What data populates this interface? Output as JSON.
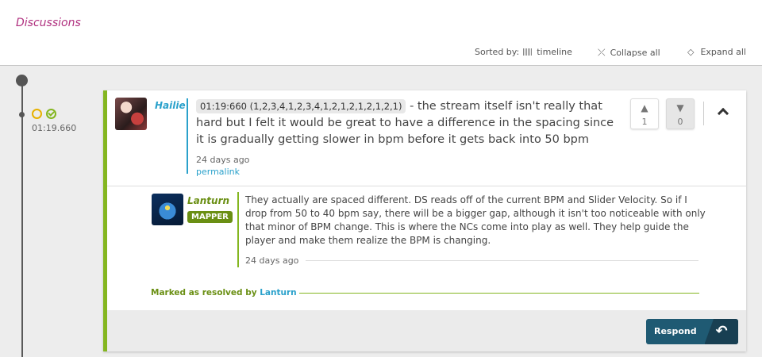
{
  "header": {
    "title": "Discussions",
    "sorted_by_label": "Sorted by:",
    "sort_value": "timeline",
    "collapse_all": "Collapse all",
    "expand_all": "Expand all"
  },
  "timeline": {
    "timestamp": "01:19.660"
  },
  "discussion": {
    "author": "Hailie",
    "timestamp_tag": "01:19:660 (1,2,3,4,1,2,3,4,1,2,1,2,1,2,1,2,1)",
    "message": " - the stream itself isn't really that hard but I felt it would be great to have a difference in the spacing since it is gradually getting slower in bpm before it gets back into 50 bpm",
    "date": "24 days ago",
    "permalink": "permalink",
    "upvotes": "1",
    "downvotes": "0"
  },
  "reply": {
    "author": "Lanturn",
    "badge": "MAPPER",
    "message": "They actually are spaced different. DS reads off of the current BPM and Slider Velocity. So if I drop from 50 to 40 bpm say, there will be a bigger gap, although it isn't too noticeable with only that minor of BPM change. This is where the NCs come into play as well. They help guide the player and make them realize the BPM is changing.",
    "date": "24 days ago"
  },
  "resolved": {
    "label": "Marked as resolved by",
    "by": "Lanturn"
  },
  "footer": {
    "respond": "Respond"
  },
  "colors": {
    "accent_green": "#84b620",
    "link_blue": "#2aa1cb",
    "title_pink": "#b0307f",
    "respond_bg": "#1f5a73"
  }
}
